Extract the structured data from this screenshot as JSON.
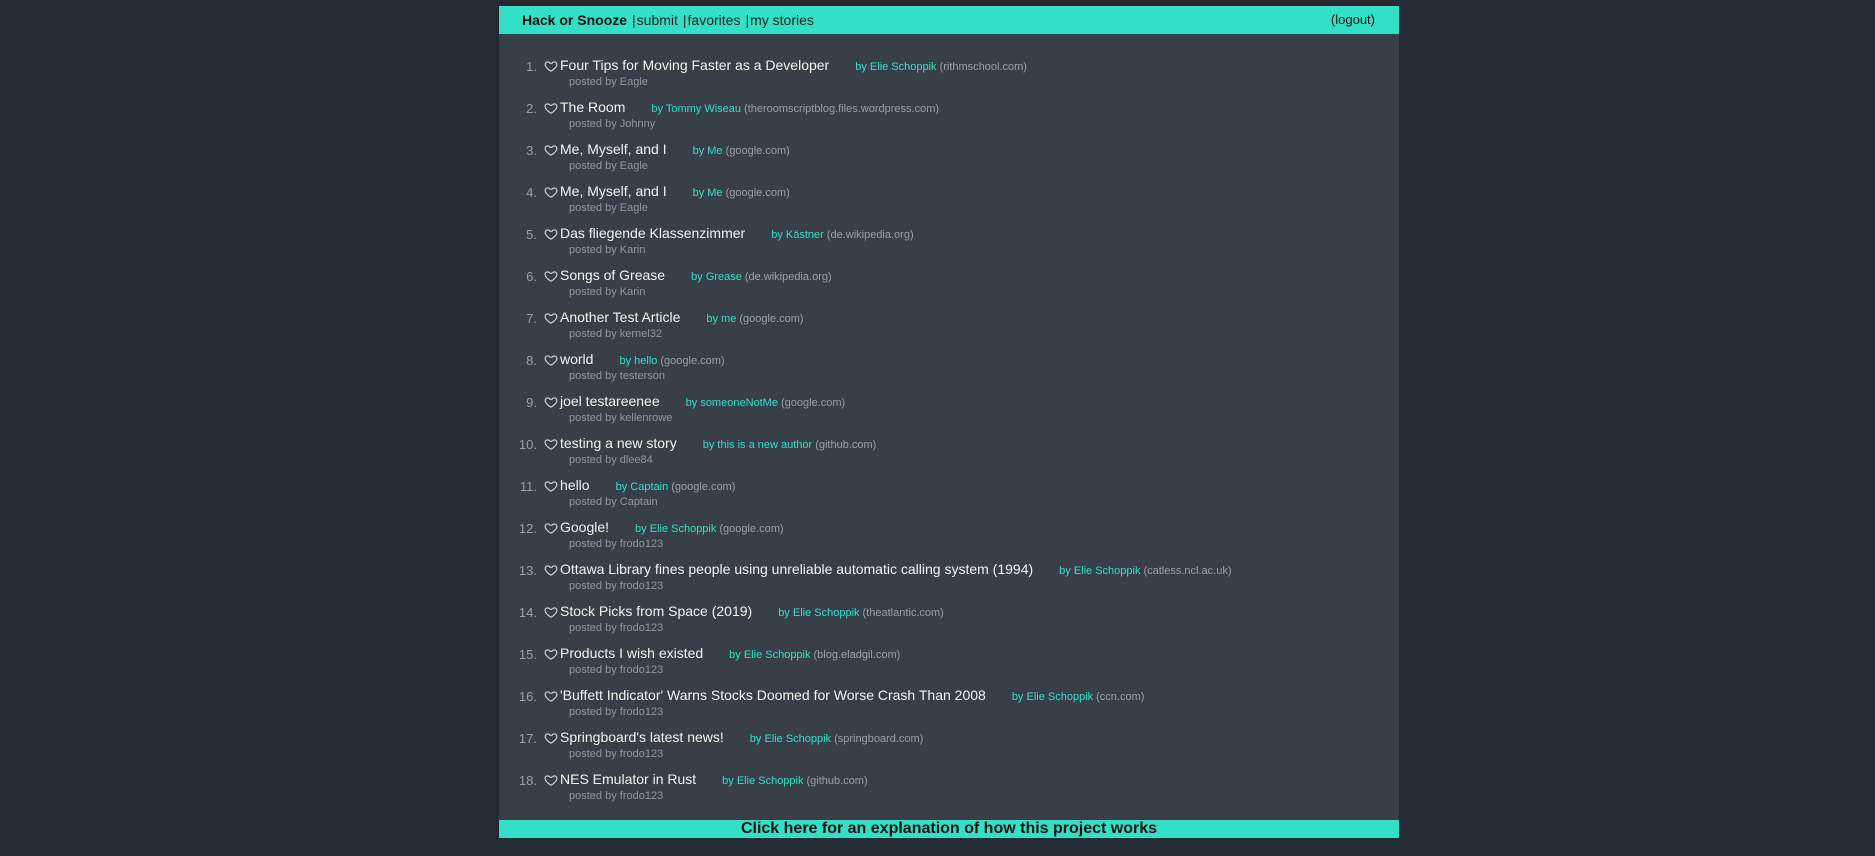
{
  "nav": {
    "brand": "Hack or Snooze",
    "links": [
      "submit",
      "favorites",
      "my stories"
    ],
    "separator": "|",
    "logout": "(logout)"
  },
  "icons": {
    "favorite": "heart-outline-icon"
  },
  "colors": {
    "accent": "#33e0c5",
    "page_bg": "#242a33",
    "panel_bg": "#383f48"
  },
  "stories": [
    {
      "num": "1.",
      "title": "Four Tips for Moving Faster as a Developer",
      "author": "by Elie Schoppik",
      "host": "(rithmschool.com)",
      "user": "posted by Eagle"
    },
    {
      "num": "2.",
      "title": "The Room",
      "author": "by Tommy Wiseau",
      "host": "(theroomscriptblog.files.wordpress.com)",
      "user": "posted by Johnny"
    },
    {
      "num": "3.",
      "title": "Me, Myself, and I",
      "author": "by Me",
      "host": "(google.com)",
      "user": "posted by Eagle"
    },
    {
      "num": "4.",
      "title": "Me, Myself, and I",
      "author": "by Me",
      "host": "(google.com)",
      "user": "posted by Eagle"
    },
    {
      "num": "5.",
      "title": "Das fliegende Klassenzimmer",
      "author": "by Kästner",
      "host": "(de.wikipedia.org)",
      "user": "posted by Karin"
    },
    {
      "num": "6.",
      "title": "Songs of Grease",
      "author": "by Grease",
      "host": "(de.wikipedia.org)",
      "user": "posted by Karin"
    },
    {
      "num": "7.",
      "title": "Another Test Article",
      "author": "by me",
      "host": "(google.com)",
      "user": "posted by kernel32"
    },
    {
      "num": "8.",
      "title": "world",
      "author": "by hello",
      "host": "(google.com)",
      "user": "posted by testerson"
    },
    {
      "num": "9.",
      "title": "joel testareenee",
      "author": "by someoneNotMe",
      "host": "(google.com)",
      "user": "posted by kellenrowe"
    },
    {
      "num": "10.",
      "title": "testing a new story",
      "author": "by this is a new author",
      "host": "(github.com)",
      "user": "posted by dlee84"
    },
    {
      "num": "11.",
      "title": "hello",
      "author": "by Captain",
      "host": "(google.com)",
      "user": "posted by Captain"
    },
    {
      "num": "12.",
      "title": "Google!",
      "author": "by Elie Schoppik",
      "host": "(google.com)",
      "user": "posted by frodo123"
    },
    {
      "num": "13.",
      "title": "Ottawa Library fines people using unreliable automatic calling system (1994)",
      "author": "by Elie Schoppik",
      "host": "(catless.ncl.ac.uk)",
      "user": "posted by frodo123"
    },
    {
      "num": "14.",
      "title": "Stock Picks from Space (2019)",
      "author": "by Elie Schoppik",
      "host": "(theatlantic.com)",
      "user": "posted by frodo123"
    },
    {
      "num": "15.",
      "title": "Products I wish existed",
      "author": "by Elie Schoppik",
      "host": "(blog.eladgil.com)",
      "user": "posted by frodo123"
    },
    {
      "num": "16.",
      "title": "'Buffett Indicator' Warns Stocks Doomed for Worse Crash Than 2008",
      "author": "by Elie Schoppik",
      "host": "(ccn.com)",
      "user": "posted by frodo123"
    },
    {
      "num": "17.",
      "title": "Springboard's latest news!",
      "author": "by Elie Schoppik",
      "host": "(springboard.com)",
      "user": "posted by frodo123"
    },
    {
      "num": "18.",
      "title": "NES Emulator in Rust",
      "author": "by Elie Schoppik",
      "host": "(github.com)",
      "user": "posted by frodo123"
    }
  ],
  "footer": {
    "text": "Click here for an explanation of how this project works"
  }
}
